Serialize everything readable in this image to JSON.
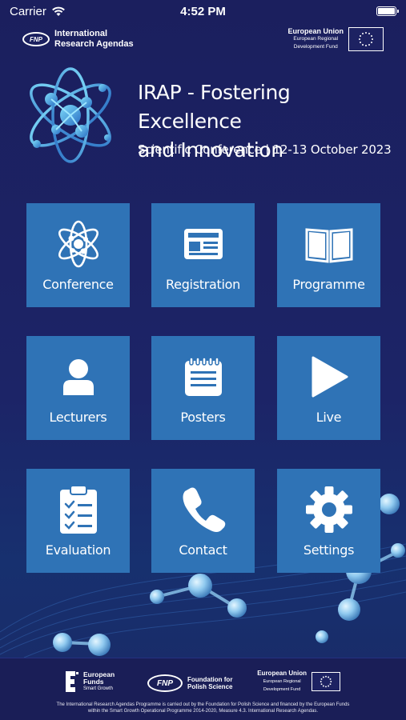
{
  "status_bar": {
    "carrier": "Carrier",
    "time": "4:52 PM"
  },
  "top_logos": {
    "fnp_mark": "FNP",
    "fnp_name_line1": "International",
    "fnp_name_line2": "Research Agendas",
    "eu_title": "European Union",
    "eu_sub_line1": "European Regional",
    "eu_sub_line2": "Development Fund"
  },
  "header": {
    "title_line1": "IRAP - Fostering Excellence",
    "title_line2": "and Innovation",
    "subtitle": "Scientific Conference | 12-13 October 2023"
  },
  "menu": {
    "conference": "Conference",
    "registration": "Registration",
    "programme": "Programme",
    "lecturers": "Lecturers",
    "posters": "Posters",
    "live": "Live",
    "evaluation": "Evaluation",
    "contact": "Contact",
    "settings": "Settings"
  },
  "footer": {
    "ef_line1": "European",
    "ef_line2": "Funds",
    "ef_line3": "Smart Growth",
    "fnp_mark": "FNP",
    "fnp_line1": "Foundation for",
    "fnp_line2": "Polish Science",
    "eu_title": "European Union",
    "eu_sub_line1": "European Regional",
    "eu_sub_line2": "Development Fund",
    "note_line1": "The International Research Agendas Programme is carried out by the Foundation for Polish Science and financed by the European Funds",
    "note_line2": "within the Smart Growth Operational Programme 2014-2020, Measure 4.3. International Research Agendas."
  },
  "colors": {
    "background": "#1d2262",
    "tile": "#2f73b6",
    "atom_light": "#5ec8f0",
    "atom_dark": "#2a78c8"
  },
  "icons": {
    "conference": "atom-icon",
    "registration": "id-card-icon",
    "programme": "open-book-icon",
    "lecturers": "person-icon",
    "posters": "notepad-icon",
    "live": "play-icon",
    "evaluation": "clipboard-checklist-icon",
    "contact": "phone-icon",
    "settings": "gear-icon"
  }
}
